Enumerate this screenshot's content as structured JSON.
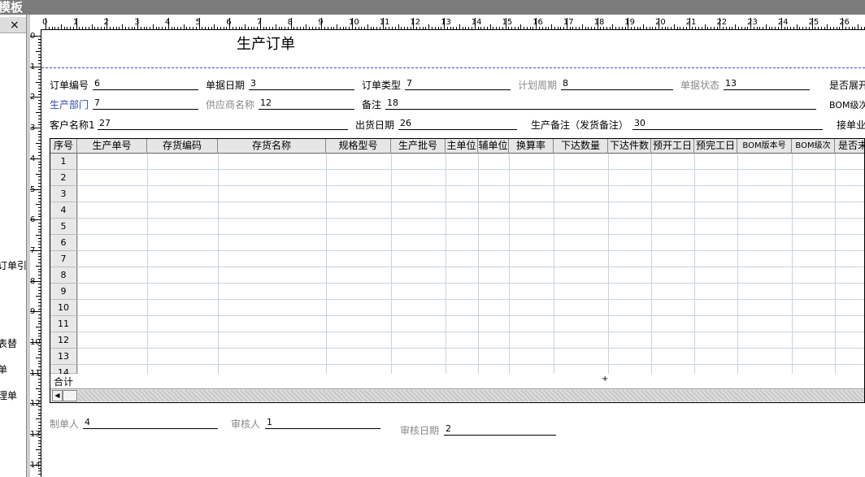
{
  "window": {
    "title": "模板"
  },
  "left_panel": {
    "close_label": "×",
    "items": [
      "订单引",
      "表替",
      "单",
      "理单"
    ]
  },
  "ruler": {
    "h_labels": [
      "0",
      "1",
      "2",
      "3",
      "4",
      "5",
      "6",
      "7",
      "8",
      "9",
      "10",
      "11",
      "12",
      "13",
      "14",
      "15",
      "16",
      "17",
      "18",
      "19",
      "20",
      "21",
      "22",
      "23",
      "24",
      "25",
      "26"
    ],
    "v_labels": [
      "0",
      "1",
      "2",
      "3",
      "4",
      "5",
      "6",
      "7",
      "8",
      "9",
      "10",
      "11",
      "12",
      "13",
      "14"
    ]
  },
  "report": {
    "title": "生产订单",
    "fields": [
      {
        "label": "订单编号",
        "value": "6",
        "style": "black"
      },
      {
        "label": "单据日期",
        "value": "3",
        "style": "black"
      },
      {
        "label": "订单类型",
        "value": "7",
        "style": "black"
      },
      {
        "label": "计划周期",
        "value": "8",
        "style": "gray"
      },
      {
        "label": "单据状态",
        "value": "13",
        "style": "gray"
      },
      {
        "label": "是否展开",
        "value": "",
        "style": "black"
      },
      {
        "label": "生产部门",
        "value": "7",
        "style": "blue"
      },
      {
        "label": "供应商名称",
        "value": "12",
        "style": "gray"
      },
      {
        "label": "备注",
        "value": "18",
        "style": "black"
      },
      {
        "label": "BOM级次",
        "value": "",
        "style": "black"
      },
      {
        "label": "客户名称1",
        "value": "27",
        "style": "black"
      },
      {
        "label": "出货日期",
        "value": "26",
        "style": "black"
      },
      {
        "label": "生产备注（发货备注）",
        "value": "30",
        "style": "gray"
      },
      {
        "label": "接单业",
        "value": "",
        "style": "black"
      }
    ],
    "table": {
      "columns": [
        "序号",
        "生产单号",
        "存货编码",
        "存货名称",
        "规格型号",
        "生产批号",
        "主单位",
        "辅单位",
        "换算率",
        "下达数量",
        "下达件数",
        "预开工日",
        "预完工日",
        "BOM版本号",
        "BOM级次",
        "是否末"
      ],
      "rows": [
        "1",
        "2",
        "3",
        "4",
        "5",
        "6",
        "7",
        "8",
        "9",
        "10",
        "11",
        "12",
        "13",
        "14"
      ],
      "sum_label": "合计",
      "sum_marker": "+"
    },
    "footer": [
      {
        "label": "制单人",
        "value": "4"
      },
      {
        "label": "审核人",
        "value": "1"
      },
      {
        "label": "审核日期",
        "value": "2"
      }
    ]
  }
}
